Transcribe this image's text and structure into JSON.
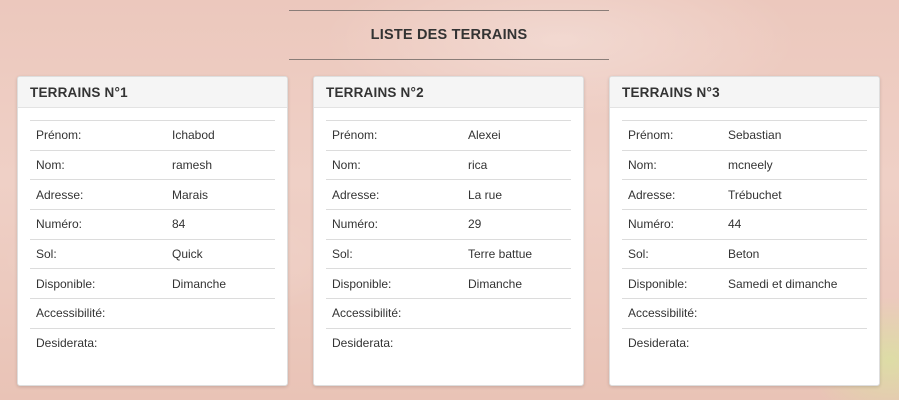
{
  "page_title": {
    "prefix": "LISTE DES",
    "strong": "TERRAINS"
  },
  "labels": {
    "prenom": "Prénom:",
    "nom": "Nom:",
    "adresse": "Adresse:",
    "numero": "Numéro:",
    "sol": "Sol:",
    "disponible": "Disponible:",
    "accessibilite": "Accessibilité:",
    "desiderata": "Desiderata:"
  },
  "cards": [
    {
      "title": "TERRAINS N°1",
      "prenom": "Ichabod",
      "nom": "ramesh",
      "adresse": "Marais",
      "numero": "84",
      "sol": "Quick",
      "disponible": "Dimanche",
      "accessibilite": "",
      "desiderata": ""
    },
    {
      "title": "TERRAINS N°2",
      "prenom": "Alexei",
      "nom": "rica",
      "adresse": "La rue",
      "numero": "29",
      "sol": "Terre battue",
      "disponible": "Dimanche",
      "accessibilite": "",
      "desiderata": ""
    },
    {
      "title": "TERRAINS N°3",
      "prenom": "Sebastian",
      "nom": "mcneely",
      "adresse": "Trébuchet",
      "numero": "44",
      "sol": "Beton",
      "disponible": "Samedi et dimanche",
      "accessibilite": "",
      "desiderata": ""
    }
  ]
}
